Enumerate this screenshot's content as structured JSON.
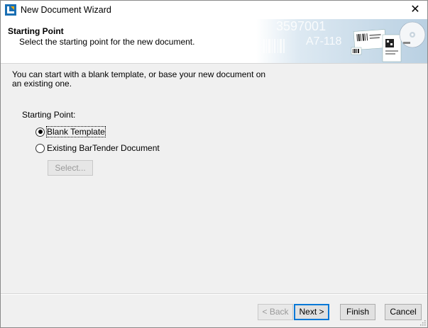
{
  "window": {
    "title": "New Document Wizard",
    "close_glyph": "✕"
  },
  "header": {
    "title": "Starting Point",
    "subtitle": "Select the starting point for the new document.",
    "art_text_1": "3597001",
    "art_text_2": "A7-118"
  },
  "content": {
    "intro": "You can start with a blank template, or base your new document on an existing one.",
    "starting_point_label": "Starting Point:",
    "options": [
      {
        "label": "Blank Template",
        "checked": true
      },
      {
        "label": "Existing BarTender Document",
        "checked": false
      }
    ],
    "select_button": "Select..."
  },
  "footer": {
    "back": "< Back",
    "next": "Next >",
    "finish": "Finish",
    "cancel": "Cancel"
  },
  "colors": {
    "accent": "#0078d7",
    "header_art": "#c9dcea"
  }
}
